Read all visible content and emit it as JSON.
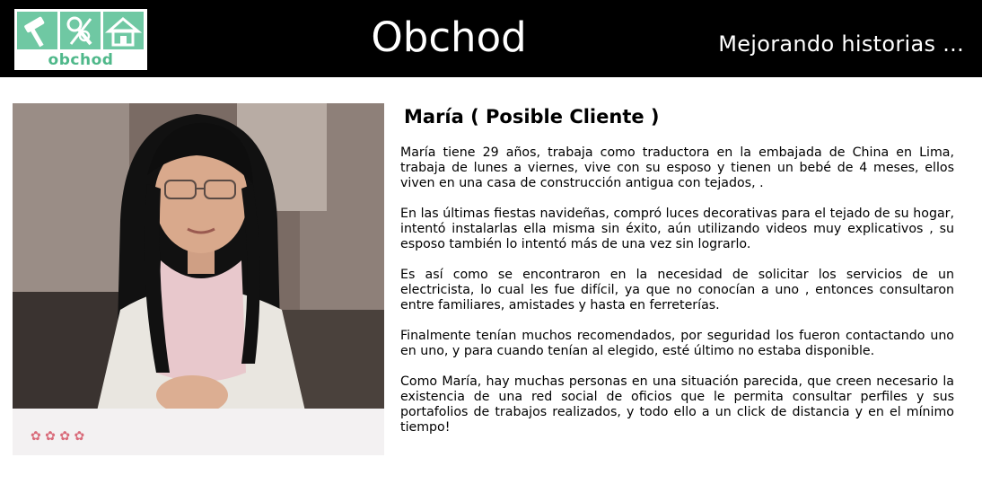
{
  "header": {
    "logo_text": "obchod",
    "site_title": "Obchod",
    "tagline": "Mejorando historias ...",
    "logo_icons": [
      "hammer-icon",
      "tools-icon",
      "house-icon"
    ],
    "colors": {
      "bar": "#000000",
      "logo_green": "#6fc8a3"
    }
  },
  "photo": {
    "icon": "woman-portrait-photo"
  },
  "story": {
    "title": "María ( Posible Cliente )",
    "paragraphs": [
      "María tiene 29 años, trabaja como traductora en la embajada de China en Lima, trabaja de lunes a viernes, vive con su esposo y tienen un bebé de 4 meses, ellos viven en una casa de construcción antigua con tejados, .",
      "En las últimas fiestas navideñas, compró luces decorativas para el tejado de su hogar, intentó instalarlas ella misma sin éxito, aún utilizando videos muy explicativos , su esposo también lo intentó más de una vez sin lograrlo.",
      "Es así como se encontraron en la necesidad de solicitar los servicios de un electricista, lo cual les fue difícil, ya que no conocían a uno , entonces consultaron entre familiares, amistades y hasta en ferreterías.",
      "Finalmente tenían muchos recomendados, por seguridad los fueron contactando uno en uno, y para cuando tenían al elegido, esté último no estaba disponible.",
      "Como María, hay muchas personas en una situación parecida, que creen necesario la existencia de una red social de oficios que le permita consultar perfiles y sus portafolios de trabajos realizados, y todo ello a un click de distancia y en el mínimo tiempo!"
    ]
  }
}
